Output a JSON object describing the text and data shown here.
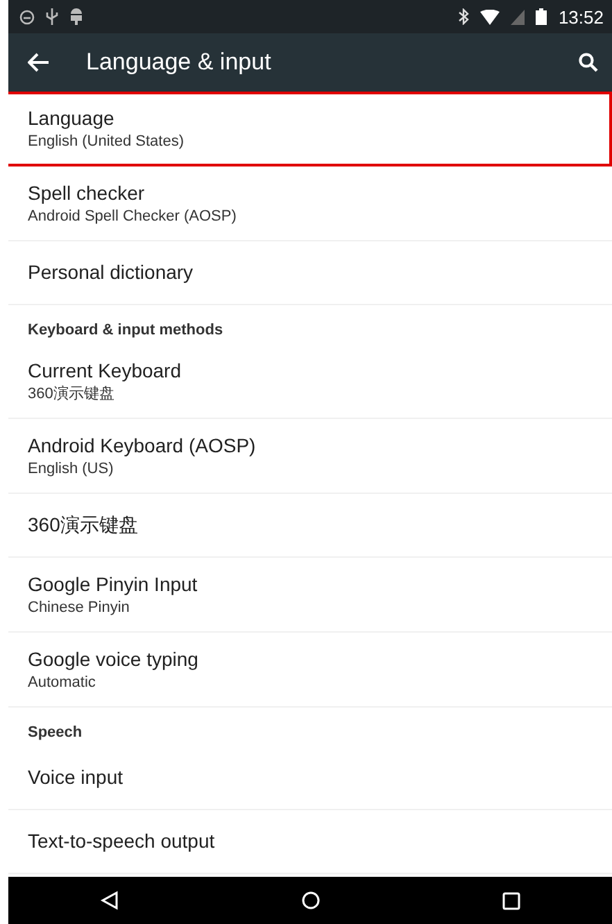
{
  "status_bar": {
    "time": "13:52"
  },
  "app_bar": {
    "title": "Language & input"
  },
  "items": [
    {
      "kind": "item",
      "title": "Language",
      "summary": "English (United States)",
      "highlighted": true
    },
    {
      "kind": "item",
      "title": "Spell checker",
      "summary": "Android Spell Checker (AOSP)",
      "highlighted": false
    },
    {
      "kind": "item",
      "title": "Personal dictionary",
      "highlighted": false
    },
    {
      "kind": "header",
      "title": "Keyboard & input methods"
    },
    {
      "kind": "item",
      "title": "Current Keyboard",
      "summary": "360演示键盘",
      "highlighted": false
    },
    {
      "kind": "item",
      "title": "Android Keyboard (AOSP)",
      "summary": "English (US)",
      "highlighted": false
    },
    {
      "kind": "item",
      "title": "360演示键盘",
      "highlighted": false
    },
    {
      "kind": "item",
      "title": "Google Pinyin Input",
      "summary": "Chinese Pinyin",
      "highlighted": false
    },
    {
      "kind": "item",
      "title": "Google voice typing",
      "summary": "Automatic",
      "highlighted": false
    },
    {
      "kind": "header",
      "title": "Speech"
    },
    {
      "kind": "item",
      "title": "Voice input",
      "highlighted": false
    },
    {
      "kind": "item",
      "title": "Text-to-speech output",
      "highlighted": false
    }
  ]
}
